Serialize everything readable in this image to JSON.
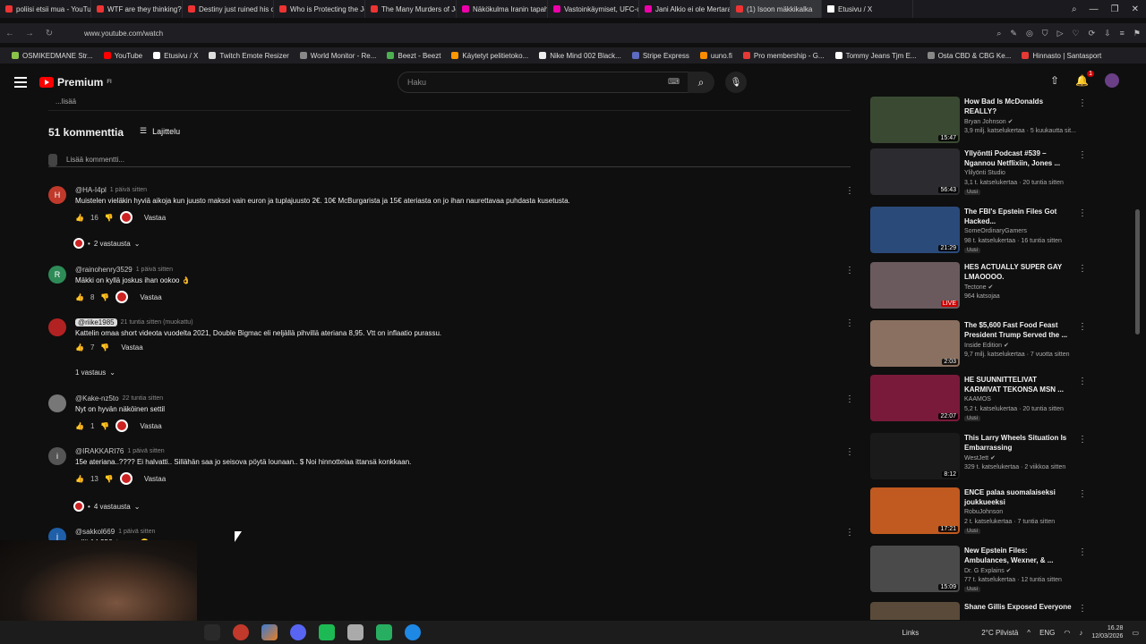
{
  "browser": {
    "tabs": [
      "poliisi etsii mua - YouTub",
      "WTF are they thinking? -",
      "Destiny just ruined his ca",
      "Who is Protecting the Jef",
      "The Many Murders of Jef",
      "Näkökulma Iranin tapahtu",
      "Vastoinkäymiset, UFC-ur",
      "Jani Alkio ei ole Mertaran",
      "(1) Isoon mäkkikalka",
      "Etusivu / X"
    ],
    "url": "www.youtube.com/watch",
    "bookmarks": [
      "OSMIKEDMANE Str...",
      "YouTube",
      "Etusivu / X",
      "Twitch Emote Resizer",
      "World Monitor - Re...",
      "Beezt - Beezt",
      "Käytetyt pelitietoko...",
      "Nike Mind 002 Black...",
      "Stripe Express",
      "uuno.fi",
      "Pro membership - G...",
      "Tommy Jeans Tjm E...",
      "Osta CBD & CBG Ke...",
      "Hinnasto | Santasport"
    ]
  },
  "header": {
    "logo_text": "Premium",
    "logo_sup": "FI",
    "search_placeholder": "Haku",
    "notification_count": "1"
  },
  "comments_section": {
    "more_text": "...lisää",
    "count_label": "51 kommenttia",
    "sort_label": "Lajittelu",
    "add_placeholder": "Lisää kommentti...",
    "reply_label": "Vastaa",
    "comments": [
      {
        "avatar": "H",
        "avatar_color": "#c0392b",
        "author": "@HA-I4pl",
        "time": "1 päivä sitten",
        "text": "Muistelen vieläkin hyviä aikoja kun juusto maksoi vain euron ja tuplajuusto 2€. 10€ McBurgarista ja 15€ ateriasta on jo ihan naurettavaa puhdasta kusetusta.",
        "likes": "16",
        "replies": "2 vastausta"
      },
      {
        "avatar": "R",
        "avatar_color": "#2e8b57",
        "author": "@rainohenry3529",
        "time": "1 päivä sitten",
        "text": "Mäkki on kyllä joskus ihan ookoo 👌",
        "likes": "8",
        "replies": ""
      },
      {
        "avatar": "",
        "avatar_color": "#b22222",
        "author": "@riike1985",
        "time": "21 tuntia sitten (muokattu)",
        "text": "Kattelin omaa short videota vuodelta 2021, Double Bigmac eli neljällä pihvillä ateriana 8,95. Vtt on inflaatio purassu.",
        "likes": "7",
        "replies": "1 vastaus"
      },
      {
        "avatar": "",
        "avatar_color": "#777777",
        "author": "@Kake-nz5to",
        "time": "22 tuntia sitten",
        "text": "Nyt on hyvän näköinen settil",
        "likes": "1",
        "replies": ""
      },
      {
        "avatar": "i",
        "avatar_color": "#555555",
        "author": "@IRAKKARI76",
        "time": "1 päivä sitten",
        "text": "15e ateriana..???? Ei halvatti.. Sillähän saa jo seisova pöytä lounaan.. $ Noi hinnottelaa ittansä konkkaan.",
        "likes": "13",
        "replies": "4 vastausta"
      },
      {
        "avatar": "j",
        "avatar_color": "#1e5fa8",
        "author": "@sakkol669",
        "time": "1 päivä sitten",
        "text": "...llä 14,25€, terve... 😀",
        "likes": "",
        "replies": ""
      }
    ]
  },
  "sidebar": {
    "videos": [
      {
        "title": "How Bad Is McDonalds REALLY?",
        "channel": "Bryan Johnson ✔",
        "meta": "3,9 milj. katselukertaa · 5 kuukautta sit...",
        "duration": "15:47",
        "badge": "",
        "thumb": "#3a4a32"
      },
      {
        "title": "Yllyöntti Podcast #539 – Ngannou Netflixiin, Jones ...",
        "channel": "Ylilyönti Studio",
        "meta": "3,1 t. katselukertaa · 20 tuntia sitten",
        "duration": "56:43",
        "badge": "Uusi",
        "thumb": "#2c2c30"
      },
      {
        "title": "The FBI's Epstein Files Got Hacked...",
        "channel": "SomeOrdinaryGamers",
        "meta": "98 t. katselukertaa · 16 tuntia sitten",
        "duration": "21:29",
        "badge": "Uusi",
        "thumb": "#2a4a7a"
      },
      {
        "title": "HES ACTUALLY SUPER GAY LMAOOOO.",
        "channel": "Tectone ✔",
        "meta": "964 katsojaa",
        "duration": "LIVE",
        "badge": "",
        "thumb": "#6a5a5e"
      },
      {
        "title": "The $5,600 Fast Food Feast President Trump Served the ...",
        "channel": "Inside Edition ✔",
        "meta": "9,7 milj. katselukertaa · 7 vuotta sitten",
        "duration": "2:03",
        "badge": "",
        "thumb": "#8a7060"
      },
      {
        "title": "HE SUUNNITTELIVAT KARMIVAT TEKONSA MSN ...",
        "channel": "KAAMOS",
        "meta": "5,2 t. katselukertaa · 20 tuntia sitten",
        "duration": "22:07",
        "badge": "Uusi",
        "thumb": "#7a1a3a"
      },
      {
        "title": "This Larry Wheels Situation Is Embarrassing",
        "channel": "WestJett ✔",
        "meta": "329 t. katselukertaa · 2 viikkoa sitten",
        "duration": "8:12",
        "badge": "",
        "thumb": "#1a1a1a"
      },
      {
        "title": "ENCE palaa suomalaiseksi joukkueeksi",
        "channel": "RobuJohnson",
        "meta": "2 t. katselukertaa · 7 tuntia sitten",
        "duration": "17:21",
        "badge": "Uusi",
        "thumb": "#c05a20"
      },
      {
        "title": "New Epstein Files: Ambulances, Wexner, & ...",
        "channel": "Dr. G Explains ✔",
        "meta": "77 t. katselukertaa · 12 tuntia sitten",
        "duration": "15:09",
        "badge": "Uusi",
        "thumb": "#4a4a4a"
      },
      {
        "title": "Shane Gillis Exposed Everyone",
        "channel": "",
        "meta": "",
        "duration": "",
        "badge": "",
        "thumb": "#5a4a3a"
      }
    ]
  },
  "taskbar": {
    "links_label": "Links",
    "weather": "2°C Pilvistä",
    "lang": "ENG",
    "time": "16.28",
    "date": "12/03/2026"
  }
}
